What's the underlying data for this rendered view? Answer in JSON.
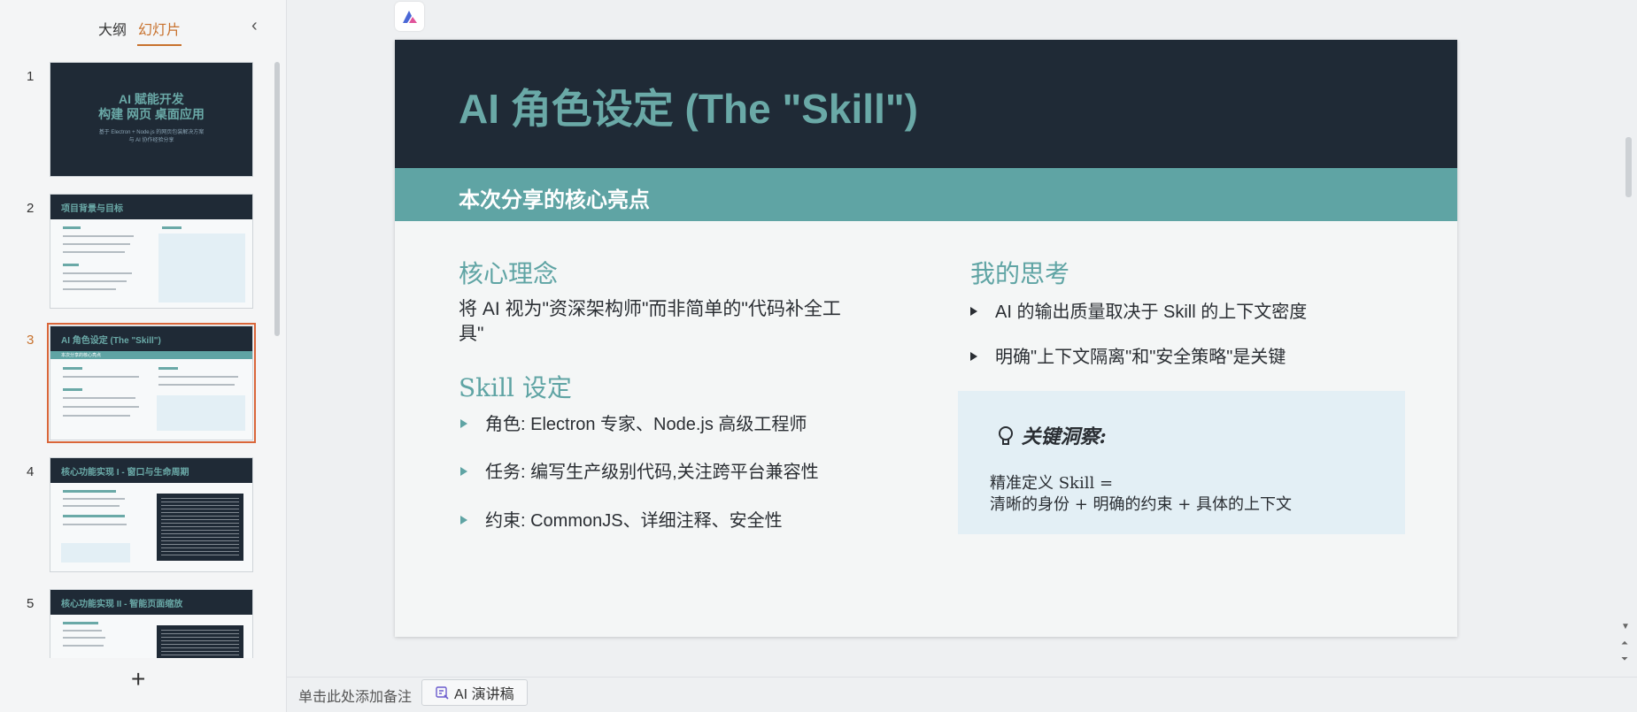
{
  "left_panel": {
    "tab_outline": "大纲",
    "tab_slides": "幻灯片",
    "collapse_icon": "chevron-left-icon",
    "add_icon": "plus-icon",
    "thumbnails": [
      {
        "number": "1",
        "title_line1": "AI 赋能开发",
        "title_line2": "构建 网页 桌面应用",
        "subtitle_line1": "基于 Electron + Node.js 的网页包装解决方案",
        "subtitle_line2": "与 AI 协作经验分享"
      },
      {
        "number": "2",
        "title": "项目背景与目标"
      },
      {
        "number": "3",
        "title": "AI 角色设定 (The \"Skill\")",
        "band": "本次分享的核心亮点"
      },
      {
        "number": "4",
        "title": "核心功能实现 I - 窗口与生命周期"
      },
      {
        "number": "5",
        "title": "核心功能实现 II - 智能页面缩放"
      }
    ]
  },
  "slide": {
    "title": "AI 角色设定 (The \"Skill\")",
    "subtitle": "本次分享的核心亮点",
    "core_concept": {
      "heading": "核心理念",
      "text_line1": "将 AI 视为\"资深架构师\"而非简单的\"代码补全工",
      "text_line2": "具\""
    },
    "skill_setting": {
      "heading": "Skill 设定",
      "bullets": [
        "角色: Electron 专家、Node.js 高级工程师",
        "任务: 编写生产级别代码,关注跨平台兼容性",
        "约束: CommonJS、详细注释、安全性"
      ]
    },
    "my_thoughts": {
      "heading": "我的思考",
      "bullets": [
        "AI 的输出质量取决于 Skill 的上下文密度",
        "明确\"上下文隔离\"和\"安全策略\"是关键"
      ]
    },
    "insight": {
      "icon": "lightbulb-icon",
      "title": "关键洞察:",
      "line1": "精准定义 Skill =",
      "line2": "清晰的身份 + 明确的约束 + 具体的上下文"
    }
  },
  "notes_bar": {
    "placeholder": "单击此处添加备注",
    "ai_button": "AI 演讲稿"
  },
  "colors": {
    "accent_orange": "#c8722e",
    "slide_dark": "#1f2a36",
    "teal": "#5fa4a4",
    "insight_bg": "#e3eff5"
  }
}
